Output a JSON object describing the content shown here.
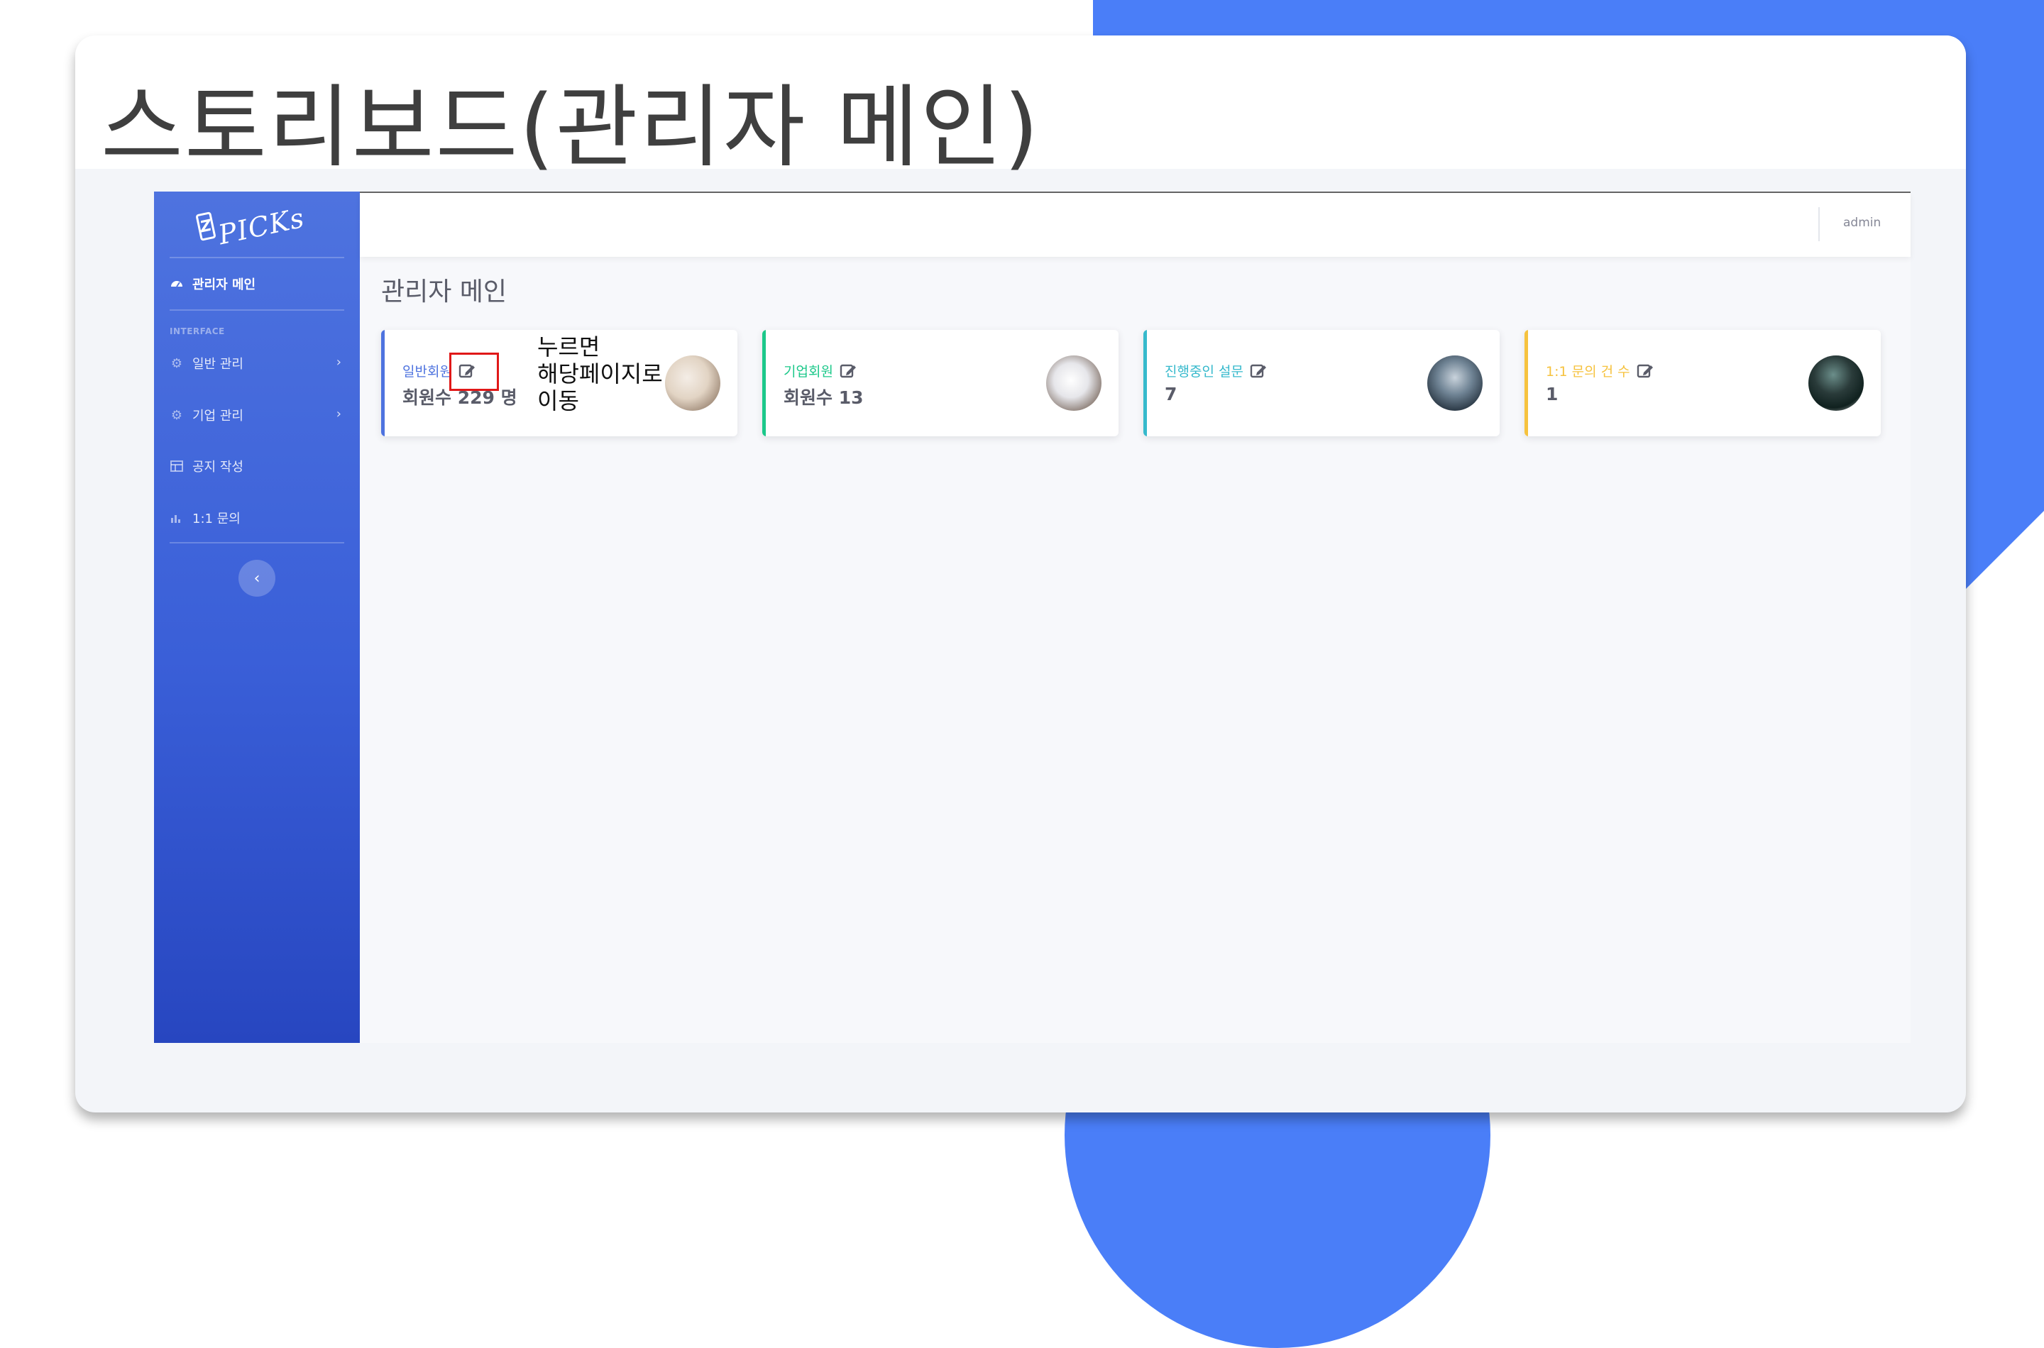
{
  "slide": {
    "title": "스토리보드(관리자 메인)"
  },
  "app": {
    "brand": {
      "logo_mark": "Z",
      "logo_text": "PICKs"
    },
    "sidebar": {
      "dashboard_label": "관리자 메인",
      "section_heading": "INTERFACE",
      "items": [
        {
          "label": "일반 관리",
          "icon": "gear-icon",
          "has_chevron": true
        },
        {
          "label": "기업 관리",
          "icon": "gear-icon",
          "has_chevron": true
        },
        {
          "label": "공지 작성",
          "icon": "table-icon",
          "has_chevron": false
        },
        {
          "label": "1:1 문의",
          "icon": "bar-chart-icon",
          "has_chevron": false
        }
      ],
      "toggle_glyph": "‹"
    },
    "topbar": {
      "user_name": "admin"
    },
    "page_heading": "관리자 메인",
    "cards": [
      {
        "label": "일반회원",
        "value": "회원수 229 명",
        "accent": "#4e73df",
        "label_color": "#4e73df"
      },
      {
        "label": "기업회원",
        "value": "회원수 13",
        "accent": "#1cc88a",
        "label_color": "#1cc88a"
      },
      {
        "label": "진행중인 설문",
        "value": "7",
        "accent": "#36b9cc",
        "label_color": "#36b9cc"
      },
      {
        "label": "1:1 문의 건 수",
        "value": "1",
        "accent": "#f6c23e",
        "label_color": "#f6c23e"
      }
    ],
    "annotation": {
      "callout_text": "누르면\n해당페이지로\n이동",
      "highlight_color": "#e01818"
    }
  },
  "colors": {
    "deco_blue": "#4a7ef8",
    "sidebar_top": "#4e73df",
    "sidebar_bottom": "#2746c0"
  }
}
